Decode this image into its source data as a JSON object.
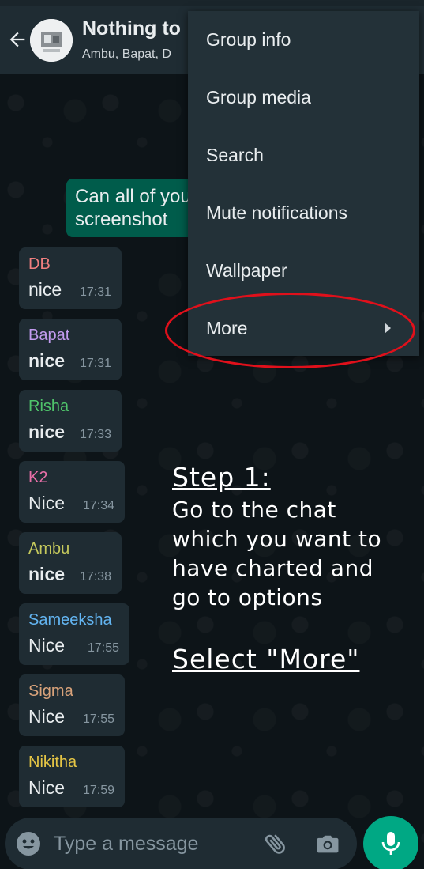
{
  "colors": {
    "header_bg": "#1f2c33",
    "menu_bg": "#233138",
    "outgoing_bubble": "#005c4b",
    "incoming_bubble": "#1f2c33",
    "accent": "#00a884",
    "highlight": "#e0101b"
  },
  "header": {
    "title": "Nothing to",
    "members": "Ambu, Bapat, D",
    "back_icon": "arrow-left-icon",
    "avatar_icon": "group-avatar"
  },
  "outgoing": {
    "line1": "Can all of you",
    "line2": "screenshot"
  },
  "messages": [
    {
      "sender": "DB",
      "sender_color": "#f07f7f",
      "text": "nice",
      "bold": false,
      "time": "17:31"
    },
    {
      "sender": "Bapat",
      "sender_color": "#c39cf0",
      "text": "nice",
      "bold": true,
      "time": "17:31"
    },
    {
      "sender": "Risha",
      "sender_color": "#4fc46b",
      "text": "nice",
      "bold": true,
      "time": "17:33"
    },
    {
      "sender": "K2",
      "sender_color": "#e86fa8",
      "text": "Nice",
      "bold": false,
      "time": "17:34"
    },
    {
      "sender": "Ambu",
      "sender_color": "#c4c85c",
      "text": "nice",
      "bold": true,
      "time": "17:38"
    },
    {
      "sender": "Sameeksha",
      "sender_color": "#63b5f2",
      "text": "Nice",
      "bold": false,
      "time": "17:55"
    },
    {
      "sender": "Sigma",
      "sender_color": "#d8a27a",
      "text": "Nice",
      "bold": false,
      "time": "17:55"
    },
    {
      "sender": "Nikitha",
      "sender_color": "#e6c645",
      "text": "Nice",
      "bold": false,
      "time": "17:59"
    }
  ],
  "menu": {
    "items": [
      {
        "label": "Group info"
      },
      {
        "label": "Group media"
      },
      {
        "label": "Search"
      },
      {
        "label": "Mute notifications"
      },
      {
        "label": "Wallpaper"
      },
      {
        "label": "More",
        "submenu_icon": "chevron-right-icon"
      }
    ]
  },
  "annotation": {
    "step_title": "Step 1:",
    "step_lines": [
      "Go to the chat",
      "which you want to",
      "have charted and",
      "go to options"
    ],
    "select_text": "Select \"More\""
  },
  "input": {
    "placeholder": "Type a message",
    "value": "",
    "emoji_icon": "emoji-icon",
    "attach_icon": "paperclip-icon",
    "camera_icon": "camera-icon",
    "mic_icon": "microphone-icon"
  }
}
